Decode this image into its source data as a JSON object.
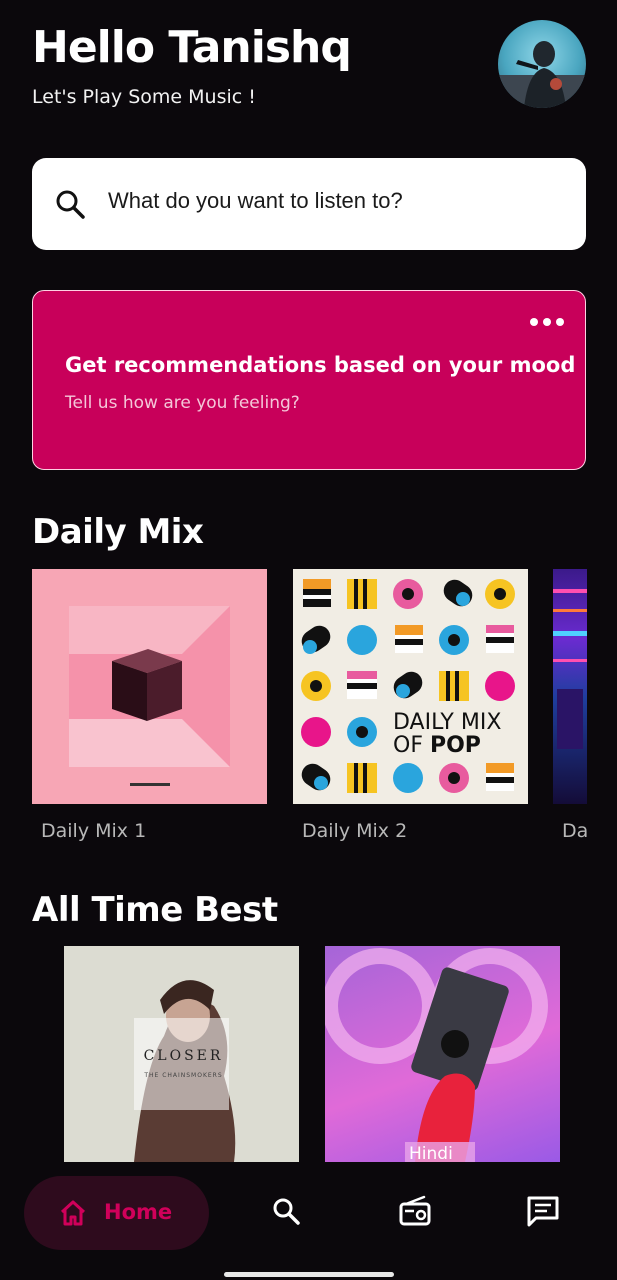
{
  "greeting": {
    "title": "Hello Tanishq",
    "subtitle": "Let's Play Some Music !"
  },
  "search": {
    "placeholder": "What do you want to listen to?"
  },
  "mood_card": {
    "title": "Get recommendations based on your mood",
    "subtitle": "Tell us how are you feeling?",
    "accent": "#c8005a"
  },
  "daily_mix": {
    "title": "Daily Mix",
    "items": [
      {
        "label": "Daily Mix 1"
      },
      {
        "label": "Daily Mix 2",
        "art_text_line1": "DAILY MIX",
        "art_text_line2a": "OF ",
        "art_text_line2b": "POP"
      },
      {
        "label": "Da"
      }
    ]
  },
  "all_time_best": {
    "title": "All Time Best",
    "items": [
      {
        "art_title": "CLOSER",
        "art_subtitle": "THE CHAINSMOKERS"
      },
      {
        "art_tag": "Hindi"
      }
    ]
  },
  "bottom_nav": {
    "items": [
      {
        "label": "Home",
        "icon": "home-icon",
        "active": true
      },
      {
        "icon": "search-icon"
      },
      {
        "icon": "radio-icon"
      },
      {
        "icon": "chat-icon"
      }
    ],
    "active_color": "#d0005a"
  }
}
